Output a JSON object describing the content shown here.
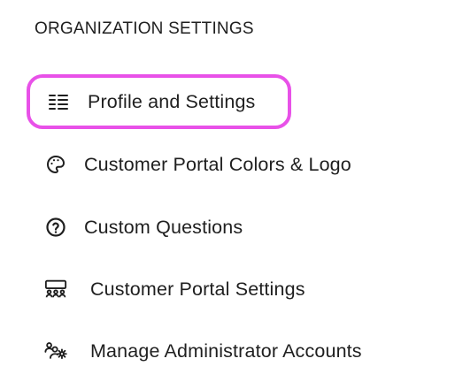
{
  "section": {
    "heading": "ORGANIZATION SETTINGS"
  },
  "menu": {
    "items": [
      {
        "label": "Profile and Settings",
        "icon": "list-icon",
        "selected": true
      },
      {
        "label": "Customer Portal Colors & Logo",
        "icon": "palette-icon",
        "selected": false
      },
      {
        "label": "Custom Questions",
        "icon": "question-circle-icon",
        "selected": false
      },
      {
        "label": "Customer Portal Settings",
        "icon": "group-icon",
        "selected": false
      },
      {
        "label": "Manage Administrator Accounts",
        "icon": "user-gear-icon",
        "selected": false
      }
    ]
  },
  "colors": {
    "selected_border": "#e851e8",
    "text": "#1f1f1f"
  }
}
